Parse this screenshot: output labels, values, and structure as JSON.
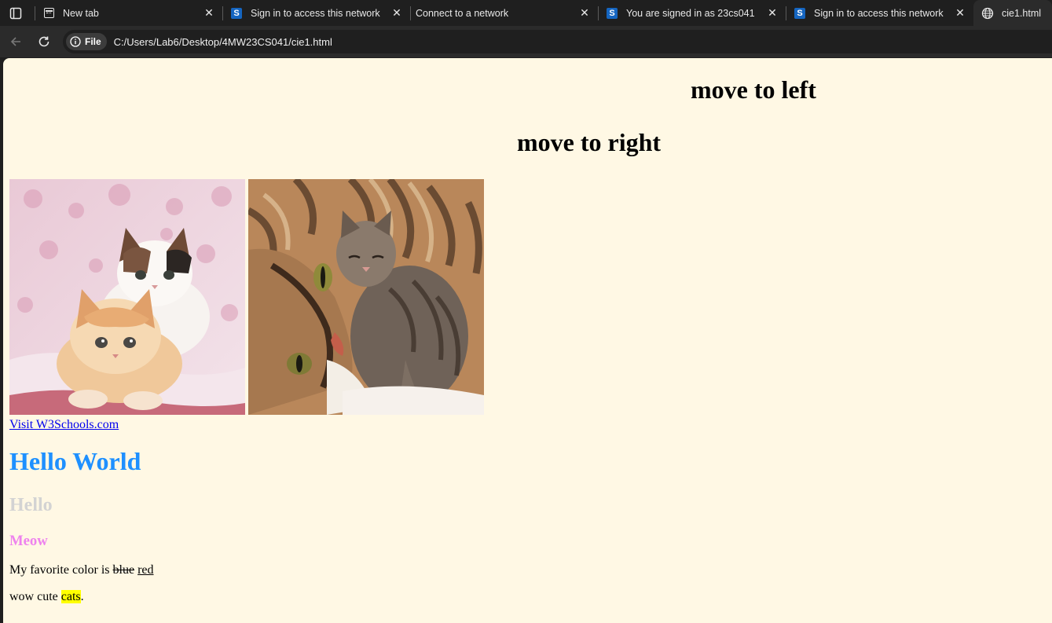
{
  "browser": {
    "tabs": [
      {
        "title": "New tab",
        "icon": "newtab-icon",
        "active": false
      },
      {
        "title": "Sign in to access this network",
        "icon": "s-favicon-icon",
        "active": false
      },
      {
        "title": "Connect to a network",
        "icon": "none",
        "active": false
      },
      {
        "title": "You are signed in as 23cs041",
        "icon": "s-favicon-icon",
        "active": false
      },
      {
        "title": "Sign in to access this network",
        "icon": "s-favicon-icon",
        "active": false
      },
      {
        "title": "cie1.html",
        "icon": "globe-icon",
        "active": true
      }
    ],
    "favicon_letter": "S",
    "address_bar": {
      "chip_label": "File",
      "url": "C:/Users/Lab6/Desktop/4MW23CS041/cie1.html"
    }
  },
  "page": {
    "background": "#fff8e4",
    "heading_left": "move to left",
    "heading_right": "move to right",
    "images": [
      {
        "name": "kittens-image",
        "description_icon": "two-kittens"
      },
      {
        "name": "cat-and-kitten-image",
        "description_icon": "cat-with-kitten"
      }
    ],
    "link_text": "Visit W3Schools.com",
    "h1": {
      "text": "Hello World",
      "color": "#1e90ff"
    },
    "h2": {
      "text": "Hello",
      "color": "#d3d3d3"
    },
    "h3": {
      "text": "Meow",
      "color": "#ee82ee"
    },
    "p1": {
      "prefix": "My favorite color is ",
      "deleted": "blue",
      "inserted": "red"
    },
    "p2": {
      "prefix": "wow cute ",
      "marked": "cats",
      "suffix": "."
    }
  }
}
